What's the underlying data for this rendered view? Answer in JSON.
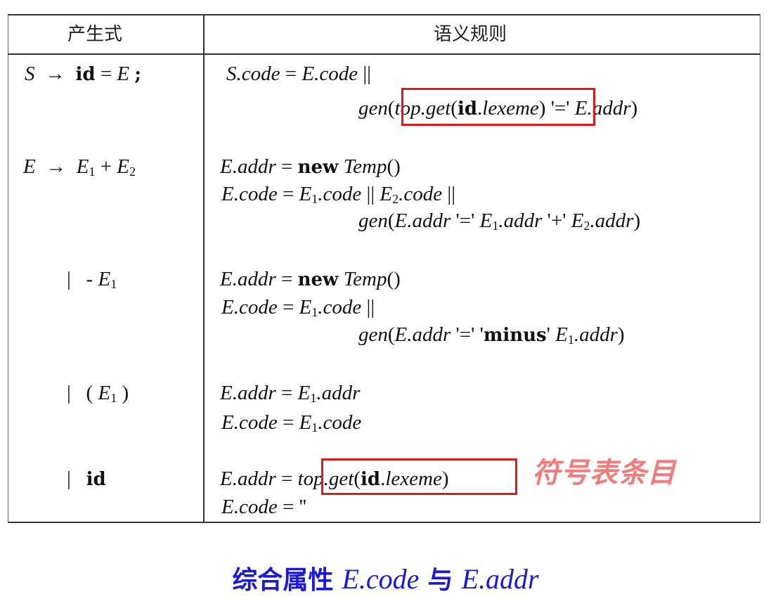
{
  "header": {
    "production": "产生式",
    "semantic_rules": "语义规则"
  },
  "rows": [
    {
      "prod_lhs": "S",
      "prod_rhs": "id = E ;",
      "rules": [
        "S.code = E.code ||",
        "gen(top.get(id.lexeme) '=' E.addr)"
      ]
    },
    {
      "prod_lhs": "E",
      "prod_rhs": "E1 + E2",
      "rules": [
        "E.addr = new Temp()",
        "E.code = E1.code || E2.code ||",
        "gen(E.addr '=' E1.addr '+' E2.addr)"
      ]
    },
    {
      "prod_lhs": "|",
      "prod_rhs": "- E1",
      "rules": [
        "E.addr = new Temp()",
        "E.code = E1.code ||",
        "gen(E.addr '=' 'minus' E1.addr)"
      ]
    },
    {
      "prod_lhs": "|",
      "prod_rhs": "( E1 )",
      "rules": [
        "E.addr = E1.addr",
        "E.code = E1.code"
      ]
    },
    {
      "prod_lhs": "|",
      "prod_rhs": "id",
      "rules": [
        "E.addr = top.get(id.lexeme)",
        "E.code = ''"
      ]
    }
  ],
  "annotation": "符号表条目",
  "caption": {
    "cjk": "综合属性",
    "attr1": "E.code",
    "conj": "与",
    "attr2": "E.addr"
  },
  "colors": {
    "highlight_box": "#e01818",
    "annotation": "#f07c7c",
    "caption": "#1a1ad6"
  }
}
